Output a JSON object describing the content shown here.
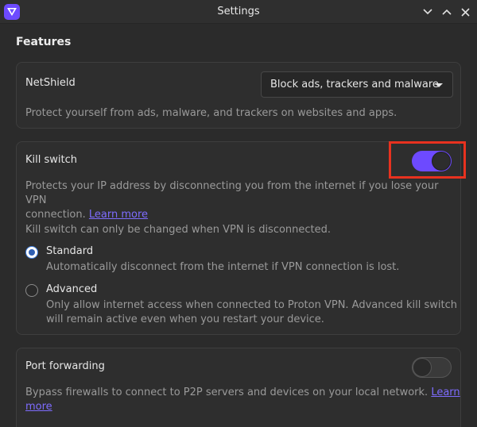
{
  "window": {
    "title": "Settings"
  },
  "features": {
    "heading": "Features"
  },
  "netshield": {
    "label": "NetShield",
    "dropdown_value": "Block ads, trackers and malware",
    "description": "Protect yourself from ads, malware, and trackers on websites and apps."
  },
  "kill_switch": {
    "label": "Kill switch",
    "enabled": true,
    "description_1": "Protects your IP address by disconnecting you from the internet if you lose your VPN",
    "description_2": "connection.",
    "learn_more": "Learn more",
    "note": "Kill switch can only be changed when VPN is disconnected.",
    "standard_label": "Standard",
    "standard_desc": "Automatically disconnect from the internet if VPN connection is lost.",
    "advanced_label": "Advanced",
    "advanced_desc_1": "Only allow internet access when connected to Proton VPN. Advanced kill switch",
    "advanced_desc_2": "will remain active even when you restart your device.",
    "selected": "Standard"
  },
  "port_forwarding": {
    "label": "Port forwarding",
    "enabled": false,
    "description": "Bypass firewalls to connect to P2P servers and devices on your local network.",
    "learn": "Learn",
    "more": "more"
  },
  "colors": {
    "accent": "#6d4aff",
    "link": "#7e6cff",
    "highlight": "#e8321f",
    "background": "#2b2b2b"
  },
  "icons": [
    "proton-vpn-logo-icon",
    "chevron-down-icon",
    "chevron-up-icon",
    "close-icon",
    "caret-down-icon"
  ]
}
